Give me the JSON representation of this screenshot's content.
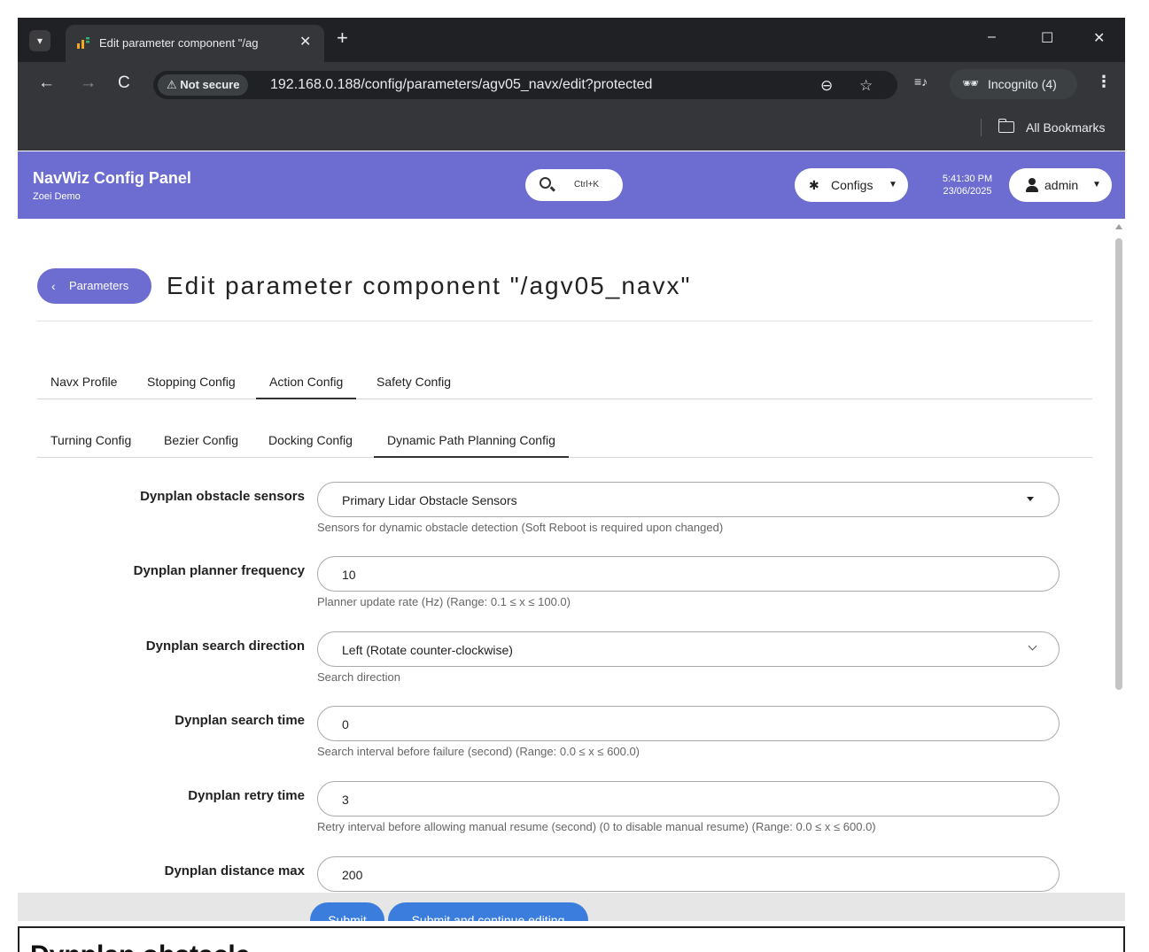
{
  "browser": {
    "tab_title": "Edit parameter component \"/ag",
    "new_tab": "+",
    "url": "192.168.0.188/config/parameters/agv05_navx/edit?protected",
    "security_label": "Not secure",
    "incognito_label": "Incognito (4)",
    "bookmarks_label": "All Bookmarks",
    "window_controls": {
      "minimize": "–",
      "maximize": "☐",
      "close": "✕"
    },
    "nav_icons": {
      "back": "←",
      "forward": "→",
      "reload": "C",
      "zoom": "⊖",
      "star": "☆"
    }
  },
  "app": {
    "title": "NavWiz Config Panel",
    "subtitle": "Zoei Demo",
    "search_hint": "Ctrl+K",
    "configs_label": "Configs",
    "time": "5:41:30 PM",
    "date": "23/06/2025",
    "user_label": "admin",
    "accent_color": "#6c6cd1"
  },
  "page": {
    "back_label": "Parameters",
    "title": "Edit parameter component \"/agv05_navx\""
  },
  "tabs_primary": [
    {
      "label": "Navx Profile",
      "active": false
    },
    {
      "label": "Stopping Config",
      "active": false
    },
    {
      "label": "Action Config",
      "active": true
    },
    {
      "label": "Safety Config",
      "active": false
    }
  ],
  "tabs_secondary": [
    {
      "label": "Turning Config",
      "active": false
    },
    {
      "label": "Bezier Config",
      "active": false
    },
    {
      "label": "Docking Config",
      "active": false
    },
    {
      "label": "Dynamic Path Planning Config",
      "active": true
    }
  ],
  "form": {
    "fields": [
      {
        "label": "Dynplan obstacle sensors",
        "value": "Primary Lidar Obstacle Sensors",
        "help": "Sensors for dynamic obstacle detection (Soft Reboot is required upon changed)",
        "control": "select"
      },
      {
        "label": "Dynplan planner frequency",
        "value": "10",
        "help": "Planner update rate (Hz) (Range: 0.1 ≤ x ≤ 100.0)",
        "control": "input"
      },
      {
        "label": "Dynplan search direction",
        "value": "Left (Rotate counter-clockwise)",
        "help": "Search direction",
        "control": "dropdown"
      },
      {
        "label": "Dynplan search time",
        "value": "0",
        "help": "Search interval before failure (second) (Range: 0.0 ≤ x ≤ 600.0)",
        "control": "input"
      },
      {
        "label": "Dynplan retry time",
        "value": "3",
        "help": "Retry interval before allowing manual resume (second) (0 to disable manual resume) (Range: 0.0 ≤ x ≤ 600.0)",
        "control": "input"
      },
      {
        "label": "Dynplan distance max",
        "value": "200",
        "help": "",
        "control": "input"
      }
    ],
    "submit_label": "Submit",
    "submit_continue_label": "Submit and continue editing"
  },
  "below_text": "Dynplan obstacle"
}
